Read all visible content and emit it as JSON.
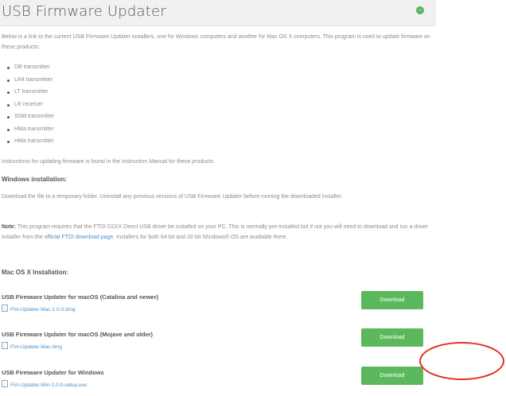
{
  "header": {
    "title": "USB Firmware Updater",
    "collapse_icon": "minus-circle-icon",
    "accent": "#5cb85c"
  },
  "intro": {
    "text": "Below is a link to the current USB Firmware Updater installers, one for Windows computers and another for Mac OS X computers. This program is used to update firmware on these products:"
  },
  "products": [
    "DB transmitter",
    "LR4 transmitter",
    "LT transmitter",
    "LR receiver",
    "SSM transmitter",
    "HMa transmitter",
    "HMa transmitter"
  ],
  "instructions": "Instructions for updating firmware is found in the Instruction Manual for these products.",
  "windows": {
    "heading": "Windows installation:",
    "text": "Download the file to a temporary folder. Uninstall any previous versions of USB Firmware Updater before running the downloaded installer.",
    "note_label": "Note:",
    "note_text_1": "This program requires that the FTDI D2XX Direct USB driver be installed on your PC. This is normally pre-installed but if not you will need to download and run a driver installer from the",
    "note_link": "official FTDI download page",
    "note_text_2": ". Installers for both 64-bit and 32-bit Windows® OS are available there."
  },
  "mac": {
    "heading": "Mac OS X Installation:"
  },
  "downloads": [
    {
      "title": "USB Firmware Updater for macOS (Catalina and newer)",
      "file": "Fim-Updater-Mac-1.0.0.dmg",
      "button": "Download"
    },
    {
      "title": "USB Firmware Updater for macOS (Mojave and older)",
      "file": "Fim-Updater-Mac.dmg",
      "button": "Download"
    },
    {
      "title": "USB Firmware Updater for Windows",
      "file": "Fim-Updater-Win-1.0.0-setup.exe",
      "button": "Download"
    }
  ],
  "annotation": {
    "color": "#e42d21"
  }
}
